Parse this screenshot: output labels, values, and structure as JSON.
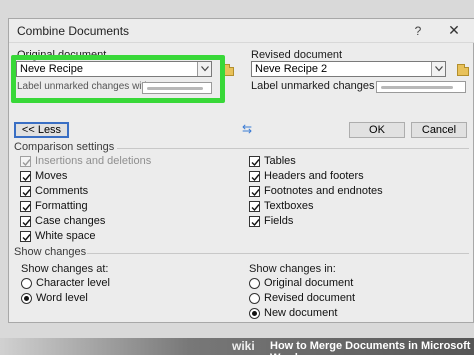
{
  "dialog": {
    "title": "Combine Documents",
    "help_label": "?",
    "close_label": "✕"
  },
  "original": {
    "label": "Original document",
    "value": "Neve Recipe",
    "unmarked_label": "Label unmarked changes with:"
  },
  "revised": {
    "label": "Revised document",
    "value": "Neve Recipe 2",
    "unmarked_label": "Label unmarked changes with:"
  },
  "swap_label": "⇆",
  "buttons": {
    "less": "<< Less",
    "ok": "OK",
    "cancel": "Cancel"
  },
  "comparison": {
    "heading": "Comparison settings",
    "left": [
      {
        "label": "Insertions and deletions",
        "checked": true,
        "disabled": true
      },
      {
        "label": "Moves",
        "checked": true,
        "disabled": false
      },
      {
        "label": "Comments",
        "checked": true,
        "disabled": false
      },
      {
        "label": "Formatting",
        "checked": true,
        "disabled": false
      },
      {
        "label": "Case changes",
        "checked": true,
        "disabled": false
      },
      {
        "label": "White space",
        "checked": true,
        "disabled": false
      }
    ],
    "right": [
      {
        "label": "Tables",
        "checked": true
      },
      {
        "label": "Headers and footers",
        "checked": true
      },
      {
        "label": "Footnotes and endnotes",
        "checked": true
      },
      {
        "label": "Textboxes",
        "checked": true
      },
      {
        "label": "Fields",
        "checked": true
      }
    ]
  },
  "show_changes": {
    "heading": "Show changes",
    "at_label": "Show changes at:",
    "at_options": [
      {
        "label": "Character level",
        "selected": false
      },
      {
        "label": "Word level",
        "selected": true
      }
    ],
    "in_label": "Show changes in:",
    "in_options": [
      {
        "label": "Original document",
        "selected": false
      },
      {
        "label": "Revised document",
        "selected": false
      },
      {
        "label": "New document",
        "selected": true
      }
    ]
  },
  "banner": {
    "wiki": "wiki",
    "how": "How to Merge Documents in Microsoft Word"
  },
  "colors": {
    "highlight": "#38d838",
    "focus": "#3a6fc4",
    "swap": "#3a7bd5"
  }
}
